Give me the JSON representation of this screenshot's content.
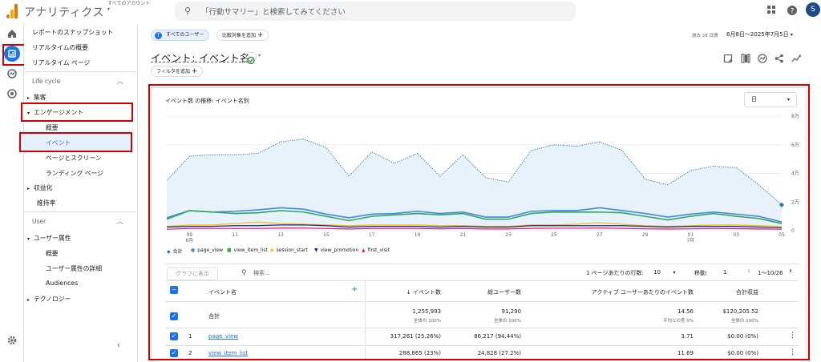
{
  "app": {
    "brand": "アナリティクス",
    "account_label": "すべてのアカウント",
    "account_arrow": "▾",
    "search_placeholder": "「行動サマリー」と検索してみてください",
    "avatar": "S"
  },
  "sidebar": {
    "items": [
      "レポートのスナップショット",
      "リアルタイムの概要",
      "リアルタイム ページ"
    ],
    "section1": "Life cycle",
    "lc": [
      "集客",
      "エンゲージメント",
      "概要",
      "イベント",
      "ページとスクリーン",
      "ランディング ページ",
      "収益化",
      "維持率"
    ],
    "section2": "User",
    "user": [
      "ユーザー属性",
      "概要",
      "ユーザー属性の詳細",
      "Audiences",
      "テクノロジー"
    ]
  },
  "header": {
    "chip_all_users": "すべてのユーザー",
    "chip_compare": "比較対象を追加",
    "date_prefix": "過去 28 日間",
    "date_range": "6月8日～2025年7月5日",
    "title": "イベント: イベント名",
    "filter": "フィルタを追加"
  },
  "card": {
    "title": "イベント数 の推移: イベント名別",
    "granularity": "日",
    "legend": [
      "合計",
      "page_view",
      "view_item_list",
      "session_start",
      "view_promotion",
      "first_visit"
    ],
    "legend_colors": [
      "#1f78b4",
      "#4285f4",
      "#34a853",
      "#fbbc04",
      "#1a237e",
      "#e91e63"
    ],
    "y_ticks": [
      "8万",
      "6万",
      "4万",
      "2万",
      "0"
    ],
    "x_ticks": [
      "09",
      "11",
      "13",
      "15",
      "17",
      "19",
      "21",
      "23",
      "25",
      "27",
      "29",
      "01",
      "03",
      "05"
    ],
    "x_sub": [
      "6月",
      "7月"
    ]
  },
  "chart_data": {
    "type": "line",
    "x": [
      "06/08",
      "06/09",
      "06/10",
      "06/11",
      "06/12",
      "06/13",
      "06/14",
      "06/15",
      "06/16",
      "06/17",
      "06/18",
      "06/19",
      "06/20",
      "06/21",
      "06/22",
      "06/23",
      "06/24",
      "06/25",
      "06/26",
      "06/27",
      "06/28",
      "06/29",
      "06/30",
      "07/01",
      "07/02",
      "07/03",
      "07/04",
      "07/05"
    ],
    "ylim": [
      0,
      80000
    ],
    "series": [
      {
        "name": "合計",
        "values": [
          35000,
          52000,
          53000,
          53000,
          54000,
          62000,
          64000,
          58000,
          38000,
          55000,
          47000,
          54000,
          38000,
          53000,
          37000,
          34000,
          56000,
          60000,
          59000,
          62000,
          56000,
          36000,
          32000,
          42000,
          45000,
          44000,
          32000,
          18000
        ]
      },
      {
        "name": "page_view",
        "values": [
          9000,
          14000,
          13000,
          13500,
          14500,
          16000,
          15000,
          11500,
          9000,
          11500,
          12000,
          13500,
          12000,
          13000,
          9500,
          9500,
          13500,
          14000,
          14000,
          16000,
          14000,
          12000,
          9500,
          11500,
          13000,
          11500,
          10000,
          6000
        ]
      },
      {
        "name": "view_item_list",
        "values": [
          8000,
          14000,
          13000,
          12000,
          12500,
          14000,
          13000,
          10000,
          7000,
          10000,
          11000,
          12000,
          11000,
          12000,
          8000,
          8000,
          12000,
          13000,
          13000,
          13000,
          12500,
          10000,
          7500,
          10000,
          12000,
          10000,
          8500,
          5000
        ]
      },
      {
        "name": "session_start",
        "values": [
          3000,
          4000,
          4000,
          5000,
          6000,
          5000,
          4500,
          4000,
          3500,
          4000,
          4000,
          4000,
          3500,
          3500,
          3000,
          3000,
          4000,
          4000,
          4500,
          5500,
          4500,
          3500,
          3000,
          3500,
          4000,
          4000,
          3500,
          3000
        ]
      },
      {
        "name": "view_promotion",
        "values": [
          2500,
          3000,
          3000,
          3500,
          3500,
          4000,
          4000,
          3500,
          2500,
          3000,
          3000,
          3000,
          2500,
          3000,
          2500,
          2500,
          3500,
          3500,
          3500,
          3500,
          3500,
          3000,
          2500,
          3000,
          3000,
          3000,
          2500,
          2000
        ]
      },
      {
        "name": "first_visit",
        "values": [
          1000,
          1500,
          1500,
          1500,
          1500,
          1800,
          1800,
          1500,
          1200,
          1500,
          1500,
          1500,
          1300,
          1500,
          1200,
          1200,
          1600,
          1700,
          1700,
          1800,
          1600,
          1300,
          1100,
          1300,
          1500,
          1400,
          1200,
          1000
        ]
      }
    ]
  },
  "table": {
    "graph_btn": "グラフに表示",
    "search": "検索...",
    "rows_per_page_label": "1 ページあたりの行数:",
    "rows_per_page": "10",
    "goto_label": "移動:",
    "goto": "1",
    "pager": "1～10/26",
    "headers": {
      "event_name": "イベント名",
      "event_count": "イベント数",
      "total_users": "総ユーザー数",
      "per_user": "アクティブ ユーザーあたりのイベント数",
      "revenue": "合計収益"
    },
    "total": {
      "label": "合計",
      "event_count": "1,255,993",
      "event_count_sub": "全体の 100%",
      "users": "91,290",
      "users_sub": "全体の 100%",
      "per_user": "14.56",
      "per_user_sub": "平均との差 0%",
      "revenue": "$120,205.52",
      "revenue_sub": "全体の 100%"
    },
    "rows": [
      {
        "idx": "1",
        "name": "page_view",
        "event_count": "317,261 (25.26%)",
        "users": "86,217 (94.44%)",
        "per_user": "3.71",
        "revenue": "$0.00 (0%)"
      },
      {
        "idx": "2",
        "name": "view_item_list",
        "event_count": "288,865 (23%)",
        "users": "24,828 (27.2%)",
        "per_user": "11.69",
        "revenue": "$0.00 (0%)"
      }
    ]
  }
}
